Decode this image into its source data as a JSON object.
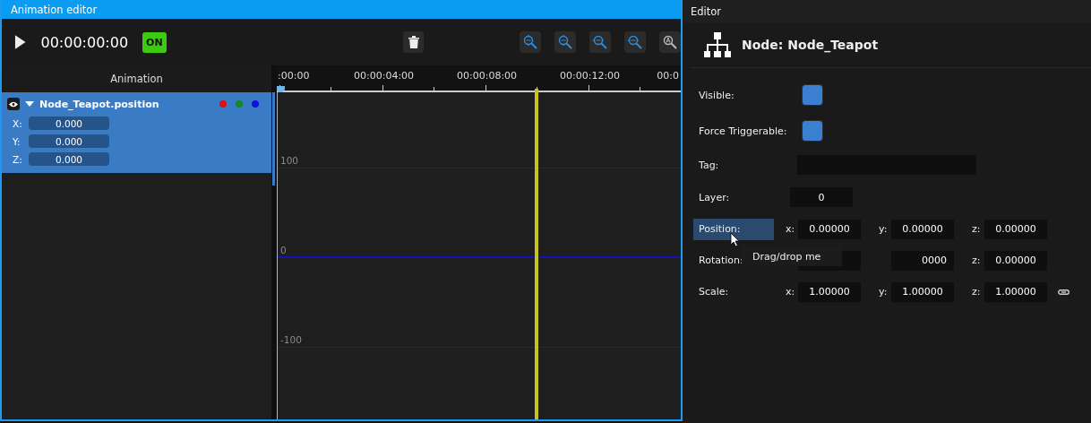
{
  "animation_editor": {
    "title": "Animation editor",
    "toolbar": {
      "time": "00:00:00:00",
      "enabled_badge": {
        "label": "ON",
        "on": true
      }
    },
    "tracks_header": "Animation",
    "tracks": [
      {
        "name": "Node_Teapot.position",
        "visible": true,
        "expanded": true,
        "selected": true,
        "channels": [
          {
            "label": "X:",
            "value": "0.000",
            "color": "#e01010"
          },
          {
            "label": "Y:",
            "value": "0.000",
            "color": "#138a1c"
          },
          {
            "label": "Z:",
            "value": "0.000",
            "color": "#1010e0"
          }
        ]
      }
    ],
    "timeline": {
      "labels": [
        ":00:00",
        "00:00:04:00",
        "00:00:08:00",
        "00:00:12:00",
        "00:0"
      ]
    },
    "graph": {
      "y_labels": [
        "100",
        "0",
        "-100"
      ]
    }
  },
  "editor": {
    "title": "Editor",
    "node_title": "Node: Node_Teapot",
    "properties": [
      {
        "kind": "checkbox",
        "label": "Visible:",
        "checked": true,
        "highlighted": false
      },
      {
        "kind": "checkbox",
        "label": "Force Triggerable:",
        "checked": true,
        "highlighted": false
      },
      {
        "kind": "text",
        "label": "Tag:",
        "highlighted": false
      },
      {
        "kind": "number",
        "label": "Layer:",
        "value": "0",
        "highlighted": false
      },
      {
        "kind": "vector",
        "label": "Position:",
        "highlighted": true,
        "fields": [
          {
            "axis": "x:",
            "value": "0.00000"
          },
          {
            "axis": "y:",
            "value": "0.00000"
          },
          {
            "axis": "z:",
            "value": "0.00000"
          }
        ]
      },
      {
        "kind": "vector",
        "label": "Rotation:",
        "highlighted": false,
        "fields": [
          {
            "value": "0000"
          },
          {
            "axis": "z:",
            "value": "0.00000"
          }
        ]
      },
      {
        "kind": "vector",
        "label": "Scale:",
        "highlighted": false,
        "linked": true,
        "fields": [
          {
            "axis": "x:",
            "value": "1.00000"
          },
          {
            "axis": "y:",
            "value": "1.00000"
          },
          {
            "axis": "z:",
            "value": "1.00000"
          }
        ]
      }
    ],
    "tooltip": "Drag/drop me"
  }
}
